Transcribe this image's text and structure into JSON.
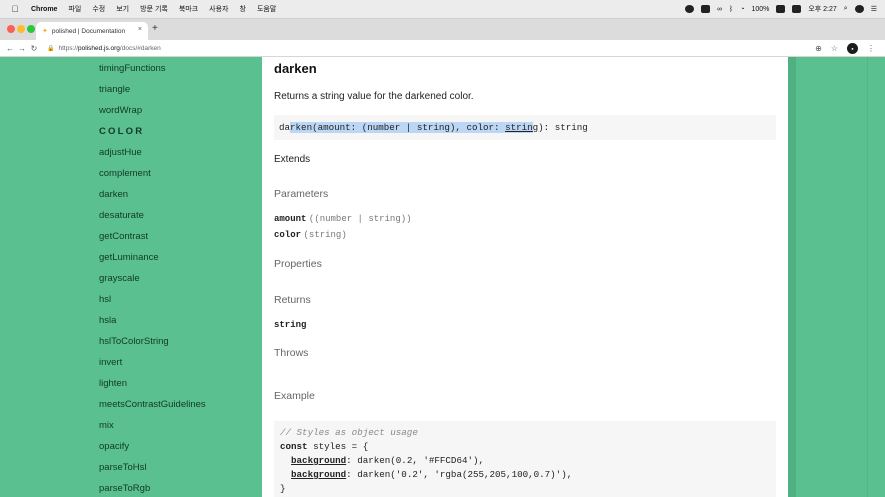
{
  "menubar": {
    "app": "Chrome",
    "items": [
      "파일",
      "수정",
      "보기",
      "방문 기록",
      "북마크",
      "사용자",
      "창",
      "도움말"
    ],
    "battery": "100%",
    "clock": "오후 2:27"
  },
  "tab": {
    "title": "polished | Documentation",
    "close": "×",
    "new_tab": "+"
  },
  "address": {
    "scheme": "https://",
    "host": "polished.js.org",
    "path": "/docs/#darken"
  },
  "sidebar": {
    "items_top": [
      "timingFunctions",
      "triangle",
      "wordWrap"
    ],
    "heading": "COLOR",
    "items": [
      "adjustHue",
      "complement",
      "darken",
      "desaturate",
      "getContrast",
      "getLuminance",
      "grayscale",
      "hsl",
      "hsla",
      "hslToColorString",
      "invert",
      "lighten",
      "meetsContrastGuidelines",
      "mix",
      "opacify",
      "parseToHsl",
      "parseToRgb"
    ]
  },
  "doc": {
    "title": "darken",
    "description": "Returns a string value for the darkened color.",
    "signature": {
      "p1": "da",
      "p2": "rken(amount: (number | string), color: ",
      "p3": "strin",
      "p4": "g",
      "p5": "): string"
    },
    "extends": "Extends",
    "parameters_heading": "Parameters",
    "params": [
      {
        "name": "amount",
        "type": "((number | string))"
      },
      {
        "name": "color",
        "type": "(string)"
      }
    ],
    "properties_heading": "Properties",
    "returns_heading": "Returns",
    "returns_type": "string",
    "throws_heading": "Throws",
    "example_heading": "Example",
    "example": {
      "comment": "// Styles as object usage",
      "kw": "const",
      "decl": " styles = {",
      "prop": "background",
      "line1_rest": ": darken(0.2, '#FFCD64'),",
      "line2_rest": ": darken('0.2', 'rgba(255,205,100,0.7)'),",
      "close": "}"
    }
  }
}
